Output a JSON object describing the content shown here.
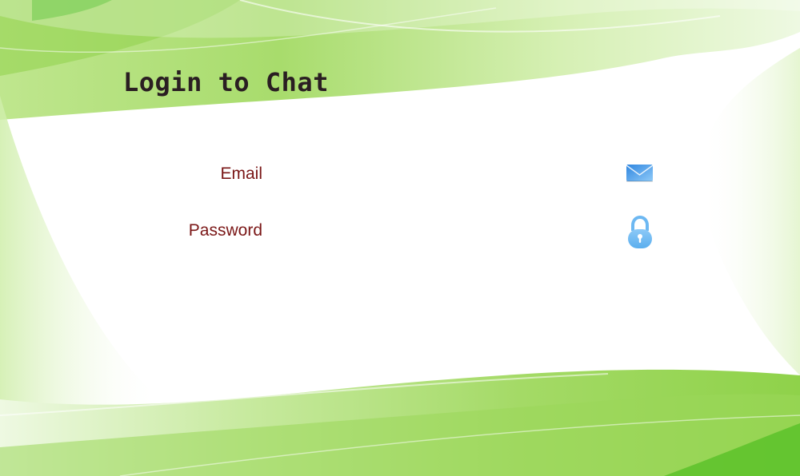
{
  "login": {
    "title": "Login to Chat",
    "email": {
      "label": "Email",
      "value": "",
      "placeholder": "",
      "icon": "envelope-icon"
    },
    "password": {
      "label": "Password",
      "value": "",
      "placeholder": "",
      "icon": "lock-icon"
    }
  },
  "colors": {
    "title_text": "#2a1e22",
    "label_text": "#7a1616",
    "background_green": "#7fcf3a",
    "background_light": "#ffffff",
    "icon_blue": "#4ea8ec"
  }
}
